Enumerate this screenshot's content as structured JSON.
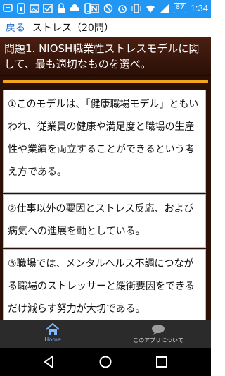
{
  "status_bar": {
    "battery": "87",
    "time": "1:34",
    "icons_left": [
      "talk-icon",
      "sim-icon",
      "image-icon",
      "check-icon",
      "lock-icon",
      "cloud-icon",
      "phone-icon"
    ],
    "icons_right": [
      "nfc-icon",
      "block-icon",
      "alarm-icon",
      "vibrate-icon",
      "wifi-icon",
      "signal-icon"
    ]
  },
  "appbar": {
    "back_label": "戻る",
    "title": "ストレス（20問）"
  },
  "question": {
    "text": "問題1. NIOSH職業性ストレスモデルに関して、最も適切なものを選べ。"
  },
  "progress": {
    "value": 1.0
  },
  "options": [
    {
      "text": "①このモデルは、「健康職場モデル」ともいわれ、従業員の健康や満足度と職場の生産性や業績を両立することができるという考え方である。"
    },
    {
      "text": "②仕事以外の要因とストレス反応、および病気への進展を軸としている。"
    },
    {
      "text": "③職場では、メンタルヘルス不調につながる職場のストレッサーと緩衝要因をできるだけ減らす努力が大切である。"
    }
  ],
  "bottom_nav": {
    "home_label": "Home",
    "about_label": "このアプリについて"
  },
  "colors": {
    "status_bar": "#2196f3",
    "question_bg": "#3b160a",
    "progress": "#f2a51a",
    "link": "#1e6fd0"
  }
}
